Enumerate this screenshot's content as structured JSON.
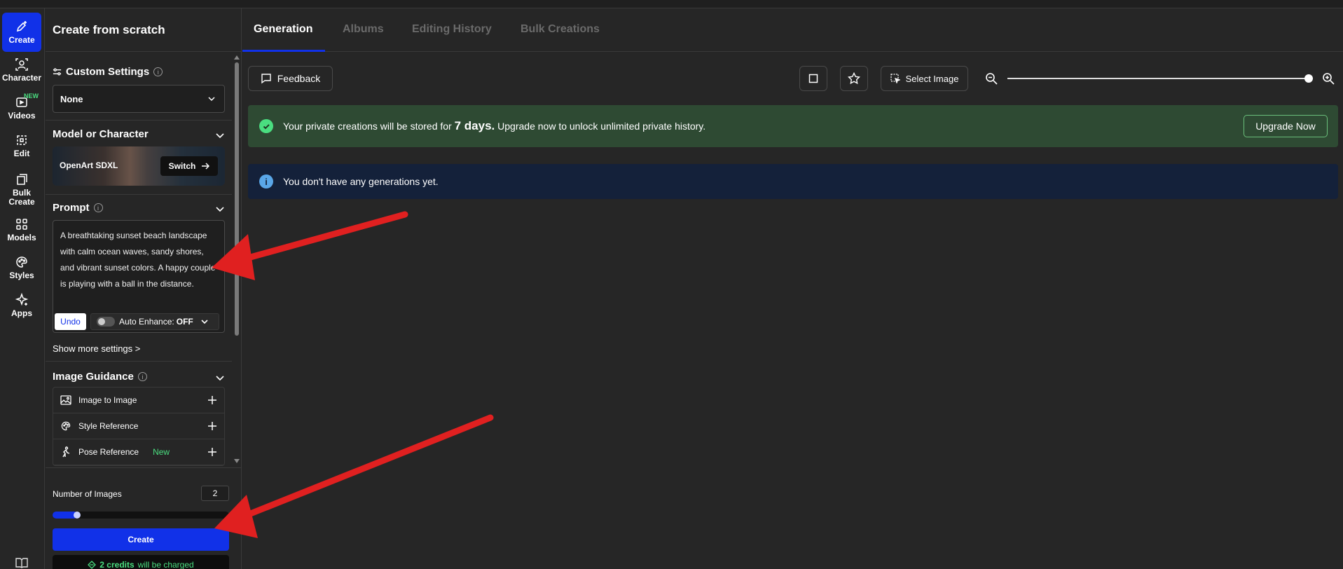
{
  "rail": {
    "items": [
      {
        "label": "Create",
        "icon": "sparkle-edit-icon",
        "active": true
      },
      {
        "label": "Character",
        "icon": "character-icon"
      },
      {
        "label": "Videos",
        "icon": "video-icon",
        "badge": "NEW"
      },
      {
        "label": "Edit",
        "icon": "edit-icon"
      },
      {
        "label": "Bulk\nCreate",
        "icon": "bulk-create-icon"
      },
      {
        "label": "Models",
        "icon": "grid-icon"
      },
      {
        "label": "Styles",
        "icon": "palette-icon"
      },
      {
        "label": "Apps",
        "icon": "apps-sparkle-icon"
      }
    ]
  },
  "panel": {
    "title": "Create from scratch",
    "custom_settings": {
      "title": "Custom Settings",
      "value": "None"
    },
    "model": {
      "title": "Model or Character",
      "name": "OpenArt SDXL",
      "switch_label": "Switch"
    },
    "prompt": {
      "title": "Prompt",
      "text": "A breathtaking sunset beach landscape with calm ocean waves, sandy shores, and vibrant sunset colors. A happy couple is playing with a ball in the distance.",
      "undo_label": "Undo",
      "enhance_label": "Auto Enhance:",
      "enhance_value": "OFF"
    },
    "more_settings": "Show more settings >",
    "guidance": {
      "title": "Image Guidance",
      "rows": [
        {
          "label": "Image to Image",
          "icon": "image-icon"
        },
        {
          "label": "Style Reference",
          "icon": "palette-icon"
        },
        {
          "label": "Pose Reference",
          "icon": "pose-icon",
          "tag": "New"
        }
      ]
    },
    "num_images": {
      "label": "Number of Images",
      "value": "2",
      "fraction": 0.12
    },
    "create_label": "Create",
    "credits": {
      "amount": "2 credits",
      "suffix": "will be charged"
    }
  },
  "main": {
    "tabs": [
      "Generation",
      "Albums",
      "Editing History",
      "Bulk Creations"
    ],
    "active_tab": 0,
    "toolbar": {
      "feedback_label": "Feedback",
      "select_image_label": "Select Image",
      "zoom_fraction": 1.0
    },
    "banner": {
      "prefix": "Your private creations will be stored for",
      "highlight": "7 days.",
      "suffix": "Upgrade now to unlock unlimited private history.",
      "button": "Upgrade Now"
    },
    "empty_message": "You don't have any generations yet."
  },
  "colors": {
    "accent": "#1131e8",
    "success": "#4ade80",
    "arrow": "#e02020"
  }
}
